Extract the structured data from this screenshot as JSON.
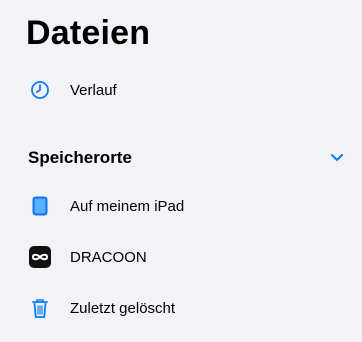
{
  "header": {
    "title": "Dateien"
  },
  "items": [
    {
      "label": "Verlauf",
      "icon": "clock-icon"
    }
  ],
  "locations": {
    "title": "Speicherorte",
    "toggle_icon": "chevron-down-icon",
    "items": [
      {
        "label": "Auf meinem iPad",
        "icon": "ipad-icon"
      },
      {
        "label": "DRACOON",
        "icon": "dracoon-logo-icon"
      },
      {
        "label": "Zuletzt gelöscht",
        "icon": "trash-icon"
      }
    ]
  },
  "colors": {
    "background": "#f2f2f7",
    "accent": "#0a7aff",
    "text": "#000000"
  }
}
